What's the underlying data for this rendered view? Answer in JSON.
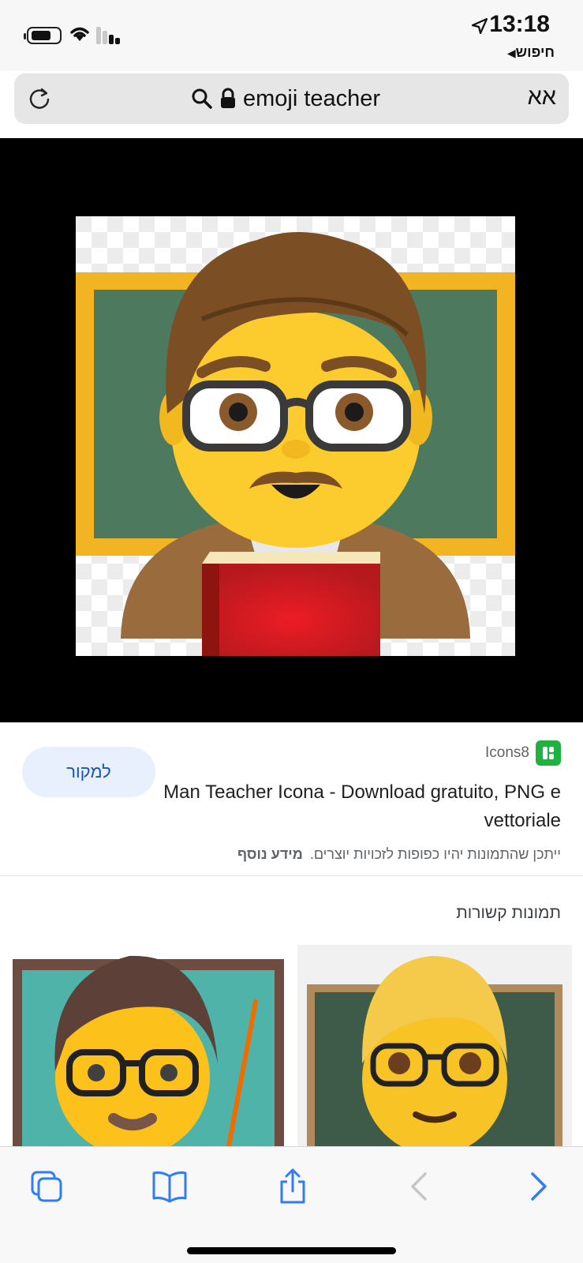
{
  "status_bar": {
    "time": "13:18",
    "back_app_label": "חיפוש",
    "back_arrow": "◀"
  },
  "address_bar": {
    "url_text": "emoji teacher",
    "text_size_label": "אא",
    "icons": [
      "reload-icon",
      "search-icon",
      "lock-icon"
    ]
  },
  "result": {
    "source_button_label": "למקור",
    "site_name": "Icons8",
    "title": "Man Teacher Icona - Download gratuito, PNG e vettoriale",
    "license_text": "ייתכן שהתמונות יהיו כפופות לזכויות יוצרים.",
    "more_info_label": "מידע נוסף"
  },
  "related": {
    "heading": "תמונות קשורות"
  },
  "toolbar": {
    "icons": [
      "tabs-icon",
      "bookmarks-icon",
      "share-icon",
      "back-icon",
      "forward-icon"
    ]
  },
  "colors": {
    "link_blue": "#1a56b8",
    "toolbar_blue": "#2f7cf6",
    "source_button_bg": "#e8f0fe",
    "site_icon_green": "#1fb141"
  }
}
